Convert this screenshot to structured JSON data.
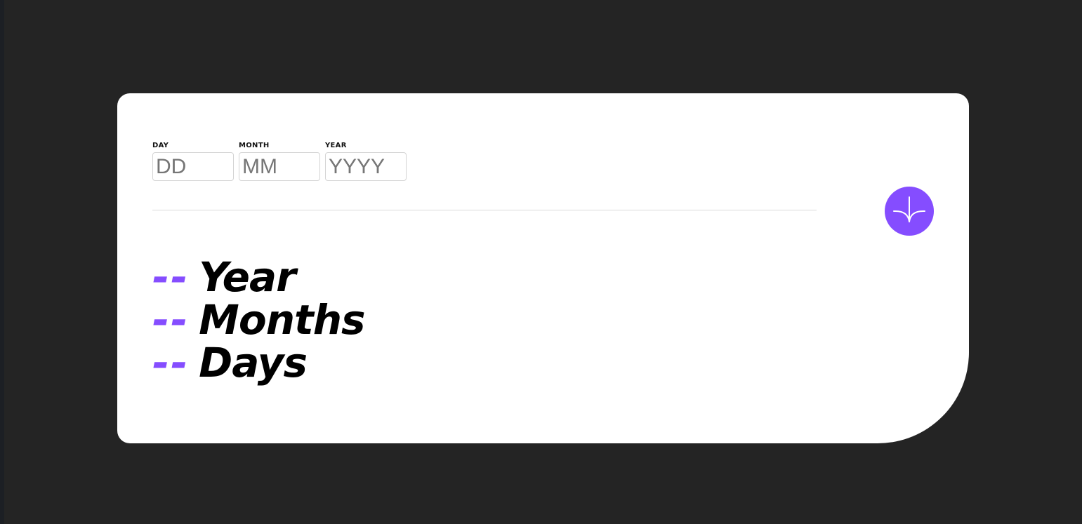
{
  "colors": {
    "background": "#242424",
    "card": "#ffffff",
    "accent": "#854dff",
    "text": "#000000",
    "placeholder": "#767676",
    "divider": "#dcdcdc"
  },
  "form": {
    "day": {
      "label": "DAY",
      "placeholder": "DD",
      "value": ""
    },
    "month": {
      "label": "MONTH",
      "placeholder": "MM",
      "value": ""
    },
    "year": {
      "label": "YEAR",
      "placeholder": "YYYY",
      "value": ""
    }
  },
  "submit": {
    "icon": "arrow-down-icon"
  },
  "results": {
    "years": {
      "value": "--",
      "unit": "Year"
    },
    "months": {
      "value": "--",
      "unit": "Months"
    },
    "days": {
      "value": "--",
      "unit": "Days"
    }
  }
}
